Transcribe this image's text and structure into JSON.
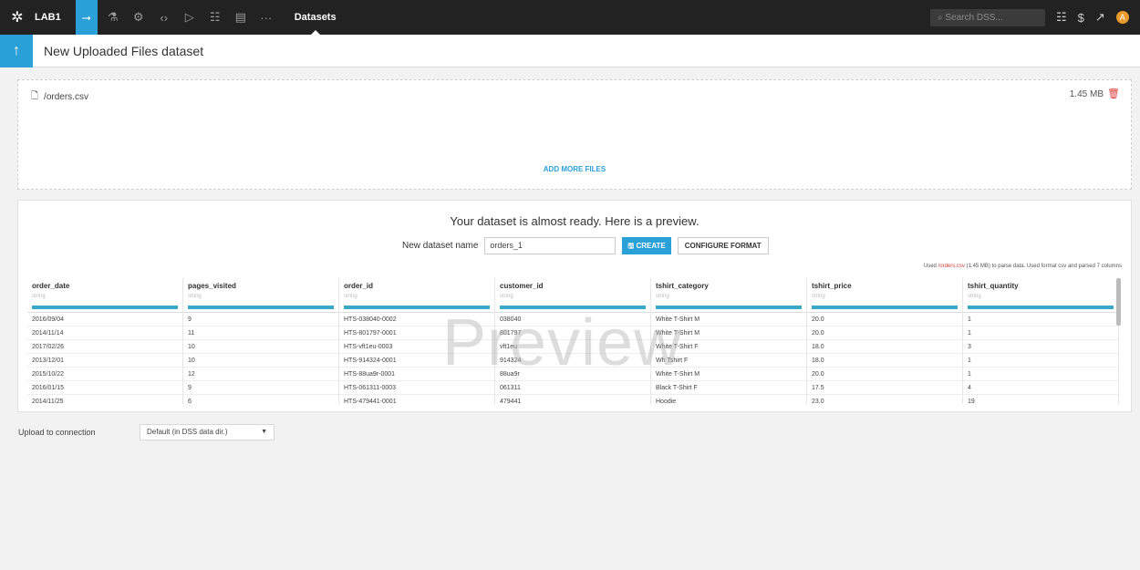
{
  "topbar": {
    "project": "LAB1",
    "section": "Datasets",
    "more": "···",
    "search_placeholder": "Search DSS...",
    "avatar": "A"
  },
  "header": {
    "title": "New Uploaded Files dataset"
  },
  "files": {
    "name": "/orders.csv",
    "size": "1.45 MB",
    "add_more": "ADD MORE FILES"
  },
  "preview": {
    "heading": "Your dataset is almost ready. Here is a preview.",
    "name_label": "New dataset name",
    "name_value": "orders_1",
    "create_label": "CREATE",
    "configure_label": "CONFIGURE FORMAT",
    "used_prefix": "Used ",
    "used_file": "/orders.csv",
    "used_suffix": " (1.45 MB) to parse data. Used format csv and parsed 7 columns",
    "watermark": "Preview"
  },
  "table": {
    "columns": [
      {
        "name": "order_date",
        "type": "string"
      },
      {
        "name": "pages_visited",
        "type": "string"
      },
      {
        "name": "order_id",
        "type": "string"
      },
      {
        "name": "customer_id",
        "type": "string"
      },
      {
        "name": "tshirt_category",
        "type": "string"
      },
      {
        "name": "tshirt_price",
        "type": "string"
      },
      {
        "name": "tshirt_quantity",
        "type": "string"
      }
    ],
    "rows": [
      [
        "2016/09/04",
        "9",
        "HTS-038040-0002",
        "038040",
        "White T-Shirt M",
        "20.0",
        "1"
      ],
      [
        "2014/11/14",
        "11",
        "HTS-801797-0001",
        "801797",
        "White T-Shirt M",
        "20.0",
        "1"
      ],
      [
        "2017/02/26",
        "10",
        "HTS-vft1eu-0003",
        "vft1eu",
        "White T-Shirt F",
        "18.0",
        "3"
      ],
      [
        "2013/12/01",
        "10",
        "HTS-914324-0001",
        "914324",
        "Wh Tshirt F",
        "18.0",
        "1"
      ],
      [
        "2015/10/22",
        "12",
        "HTS-88ua9r-0001",
        "88ua9r",
        "White T-Shirt M",
        "20.0",
        "1"
      ],
      [
        "2016/01/15",
        "9",
        "HTS-061311-0003",
        "061311",
        "Black T-Shirt F",
        "17.5",
        "4"
      ],
      [
        "2014/11/25",
        "6",
        "HTS-479441-0001",
        "479441",
        "Hoodie",
        "23.0",
        "19"
      ]
    ]
  },
  "connection": {
    "label": "Upload to connection",
    "value": "Default (in DSS data dir.)"
  }
}
